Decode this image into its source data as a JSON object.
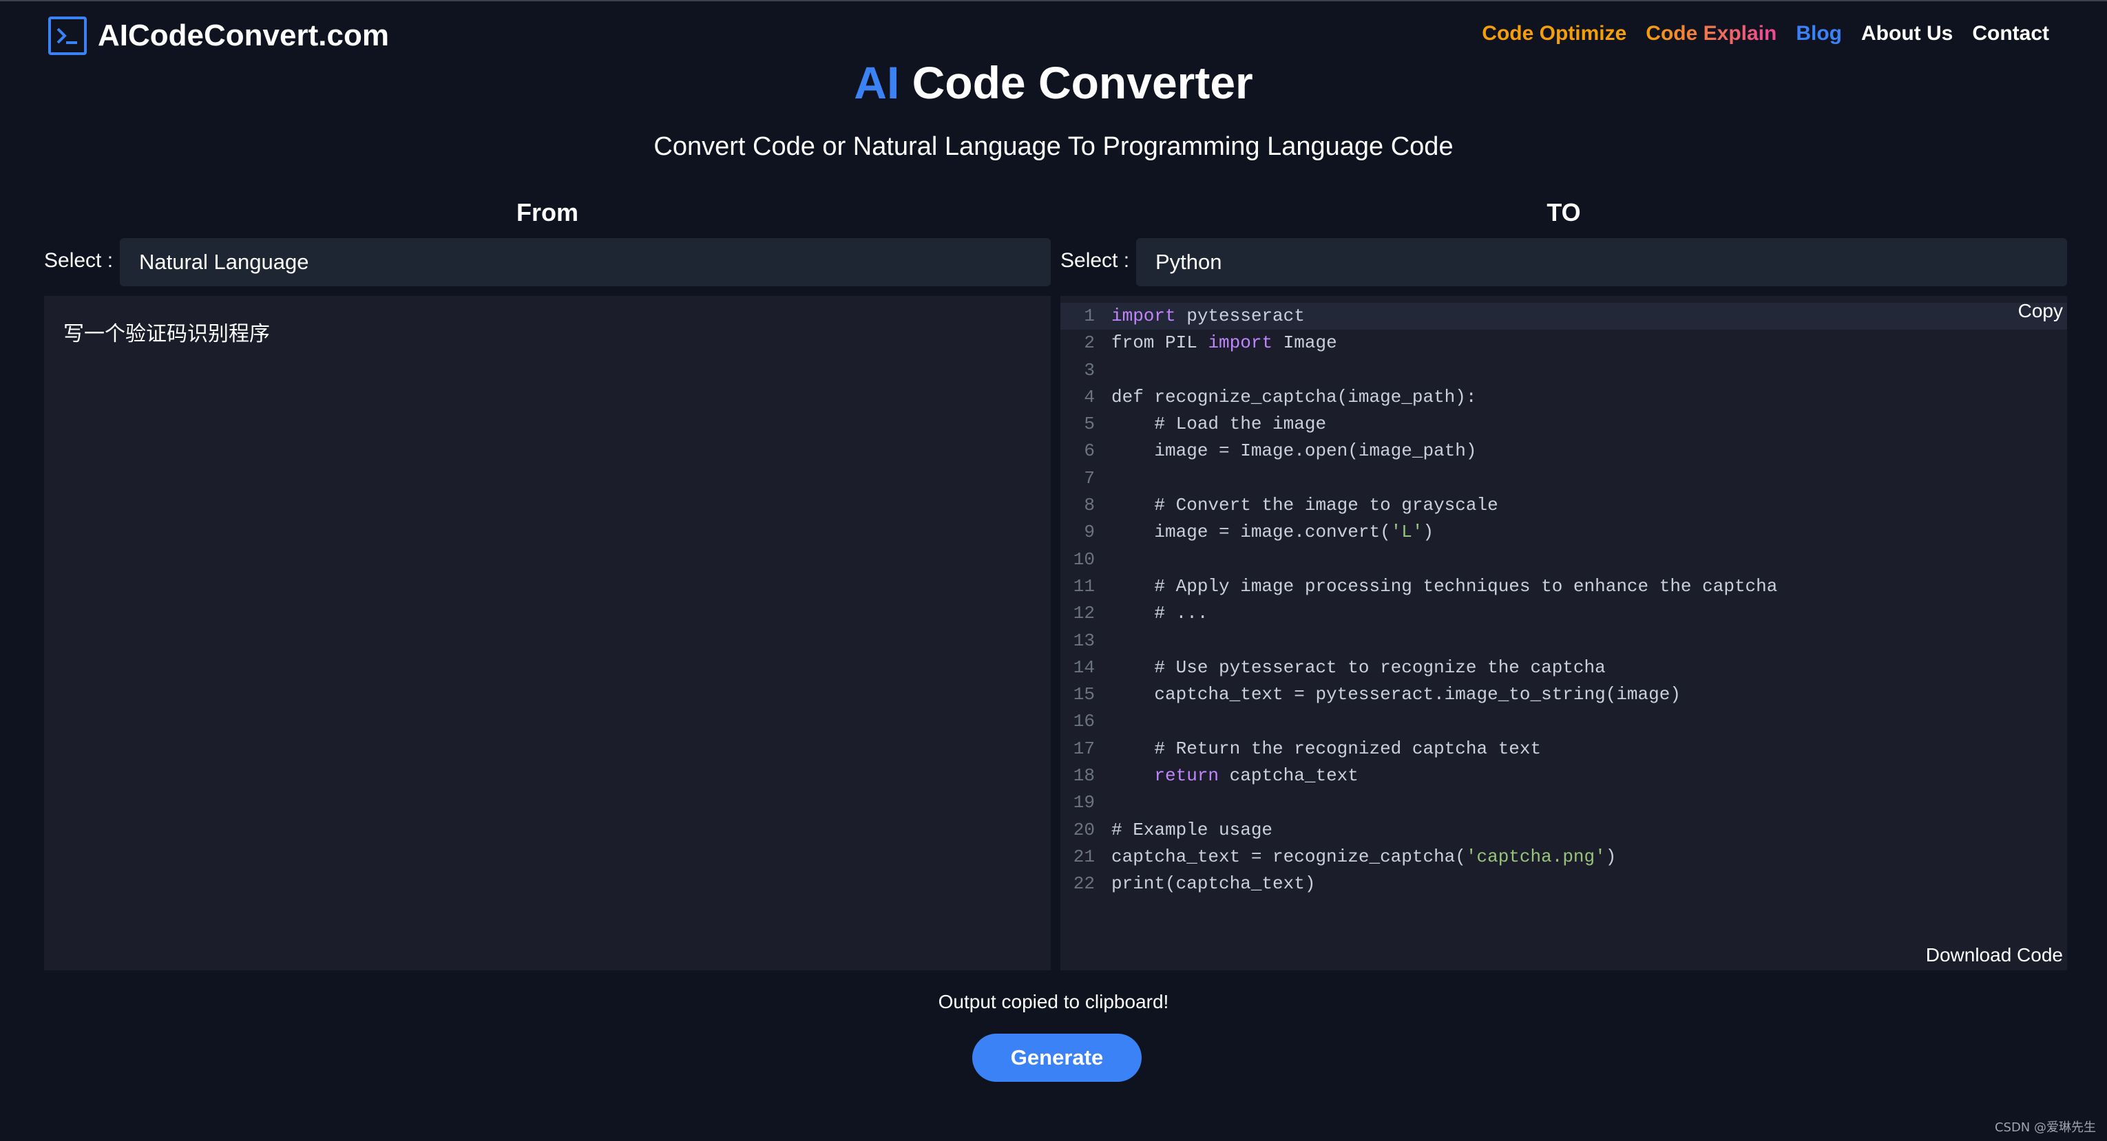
{
  "site": {
    "name": "AICodeConvert.com"
  },
  "nav": {
    "items": [
      {
        "label": "Code Optimize"
      },
      {
        "label": "Code Explain"
      },
      {
        "label": "Blog"
      },
      {
        "label": "About Us"
      },
      {
        "label": "Contact"
      }
    ]
  },
  "hero": {
    "title_accent": "AI",
    "title_rest": " Code Converter",
    "subtitle": "Convert Code or Natural Language To Programming Language Code"
  },
  "from": {
    "heading": "From",
    "select_label": "Select :",
    "selected": "Natural Language",
    "input_text": "写一个验证码识别程序"
  },
  "to": {
    "heading": "TO",
    "select_label": "Select :",
    "selected": "Python",
    "copy_label": "Copy",
    "download_label": "Download Code",
    "code_lines": [
      "import pytesseract",
      "from PIL import Image",
      "",
      "def recognize_captcha(image_path):",
      "    # Load the image",
      "    image = Image.open(image_path)",
      "",
      "    # Convert the image to grayscale",
      "    image = image.convert('L')",
      "",
      "    # Apply image processing techniques to enhance the captcha",
      "    # ...",
      "",
      "    # Use pytesseract to recognize the captcha",
      "    captcha_text = pytesseract.image_to_string(image)",
      "",
      "    # Return the recognized captcha text",
      "    return captcha_text",
      "",
      "# Example usage",
      "captcha_text = recognize_captcha('captcha.png')",
      "print(captcha_text)"
    ]
  },
  "status": {
    "message": "Output copied to clipboard!"
  },
  "actions": {
    "generate_label": "Generate"
  },
  "watermark": "CSDN @爱琳先生",
  "colors": {
    "accent": "#3b82f6",
    "background": "#0f131f",
    "panel": "#1b1e2a",
    "select_bg": "#1f2633",
    "optimize": "#f59e0b",
    "explain_start": "#f59e0b",
    "explain_end": "#ec4899"
  }
}
